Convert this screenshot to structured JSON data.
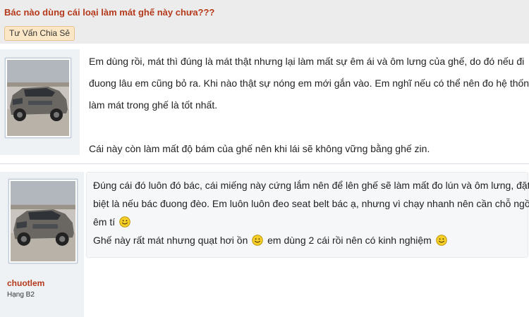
{
  "thread": {
    "title": "Bác nào dùng cái loại làm mát ghế này chưa???",
    "prefix": "Tư Vấn Chia Sẻ"
  },
  "posts": [
    {
      "lines": [
        "Em dùng rồi, mát thì đúng là mát thật nhưng lại làm mất sự êm ái và ôm lưng của ghế, do đó nếu đi",
        "đuong lâu em cũng bỏ ra. Khi nào thật sự nóng em mới gắn vào. Em nghĩ nếu có thể nên đo hệ thống",
        "làm mát trong ghế là tốt nhất.",
        "",
        "Cái này còn làm mất độ bám của ghế nên khi lái sẽ không vững bằng ghế zin."
      ]
    },
    {
      "username": "chuotlem",
      "rank": "Hạng B2",
      "lines": [
        "Đúng cái đó luôn đó bác, cái miếng này cứng lắm nên để lên ghế sẽ làm mất đo lún và ôm lưng, đặt",
        "biệt là nếu bác đuong đèo. Em luôn luôn đeo seat belt bác ạ, nhưng vì chạy nhanh nên cần chỗ ngồi",
        "êm tí"
      ],
      "line4a": "Ghế này rất mát nhưng quạt hơi ồn",
      "line4b": "em dùng 2 cái rồi nên có kinh nghiệm"
    }
  ],
  "colors": {
    "accent": "#b5391b",
    "header_bg": "#ececec",
    "user_panel_bg": "#eef2f5"
  },
  "icons": {
    "smilie": "smile-emoji-icon",
    "avatar": "car-avatar-image"
  }
}
